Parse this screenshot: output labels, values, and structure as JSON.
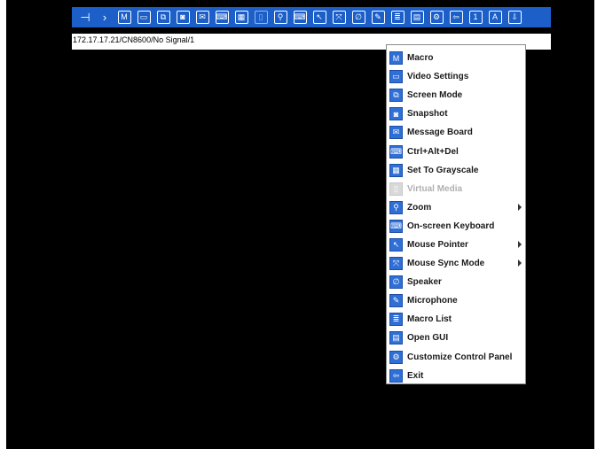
{
  "status_text": "172.17.17.21/CN8600/No Signal/1",
  "colors": {
    "toolbar_bg": "#1c5fc9",
    "screen_bg": "#000000",
    "menu_icon": "#2f6fd6",
    "disabled_text": "#b0b0b0"
  },
  "toolbar": {
    "icons": [
      {
        "name": "pin-icon",
        "glyph": "⊣"
      },
      {
        "name": "expand-arrow-icon",
        "glyph": "›"
      },
      {
        "name": "macro-icon",
        "glyph": "M"
      },
      {
        "name": "video-settings-icon",
        "glyph": "▭"
      },
      {
        "name": "screen-mode-icon",
        "glyph": "⧉"
      },
      {
        "name": "snapshot-icon",
        "glyph": "◙"
      },
      {
        "name": "message-board-icon",
        "glyph": "✉"
      },
      {
        "name": "ctrl-alt-del-icon",
        "glyph": "⌨"
      },
      {
        "name": "grayscale-icon",
        "glyph": "▦"
      },
      {
        "name": "virtual-media-icon",
        "glyph": "▯"
      },
      {
        "name": "zoom-icon",
        "glyph": "⚲"
      },
      {
        "name": "onscreen-keyboard-icon",
        "glyph": "⌨"
      },
      {
        "name": "mouse-pointer-icon",
        "glyph": "↖"
      },
      {
        "name": "mouse-sync-icon",
        "glyph": "⤧"
      },
      {
        "name": "speaker-icon",
        "glyph": "∅"
      },
      {
        "name": "microphone-icon",
        "glyph": "✎"
      },
      {
        "name": "macro-list-icon",
        "glyph": "≣"
      },
      {
        "name": "open-gui-icon",
        "glyph": "▤"
      },
      {
        "name": "customize-panel-icon",
        "glyph": "⚙"
      },
      {
        "name": "exit-icon",
        "glyph": "⇦"
      },
      {
        "name": "lock-num-icon",
        "glyph": "1"
      },
      {
        "name": "lock-caps-icon",
        "glyph": "A"
      },
      {
        "name": "lock-scroll-icon",
        "glyph": "⇩"
      }
    ]
  },
  "menu": {
    "items": [
      {
        "label": "Macro",
        "icon": "macro-icon",
        "glyph": "M",
        "submenu": false,
        "disabled": false
      },
      {
        "label": "Video Settings",
        "icon": "video-settings-icon",
        "glyph": "▭",
        "submenu": false,
        "disabled": false
      },
      {
        "label": "Screen Mode",
        "icon": "screen-mode-icon",
        "glyph": "⧉",
        "submenu": false,
        "disabled": false
      },
      {
        "label": "Snapshot",
        "icon": "snapshot-icon",
        "glyph": "◙",
        "submenu": false,
        "disabled": false
      },
      {
        "label": "Message Board",
        "icon": "message-board-icon",
        "glyph": "✉",
        "submenu": false,
        "disabled": false
      },
      {
        "label": "Ctrl+Alt+Del",
        "icon": "ctrl-alt-del-icon",
        "glyph": "⌨",
        "submenu": false,
        "disabled": false
      },
      {
        "label": "Set To Grayscale",
        "icon": "grayscale-icon",
        "glyph": "▦",
        "submenu": false,
        "disabled": false
      },
      {
        "label": "Virtual Media",
        "icon": "virtual-media-icon",
        "glyph": "▯",
        "submenu": false,
        "disabled": true
      },
      {
        "label": "Zoom",
        "icon": "zoom-icon",
        "glyph": "⚲",
        "submenu": true,
        "disabled": false
      },
      {
        "label": "On-screen Keyboard",
        "icon": "onscreen-keyboard-icon",
        "glyph": "⌨",
        "submenu": false,
        "disabled": false
      },
      {
        "label": "Mouse Pointer",
        "icon": "mouse-pointer-icon",
        "glyph": "↖",
        "submenu": true,
        "disabled": false
      },
      {
        "label": "Mouse Sync Mode",
        "icon": "mouse-sync-icon",
        "glyph": "⤧",
        "submenu": true,
        "disabled": false
      },
      {
        "label": "Speaker",
        "icon": "speaker-icon",
        "glyph": "∅",
        "submenu": false,
        "disabled": false
      },
      {
        "label": "Microphone",
        "icon": "microphone-icon",
        "glyph": "✎",
        "submenu": false,
        "disabled": false
      },
      {
        "label": "Macro List",
        "icon": "macro-list-icon",
        "glyph": "≣",
        "submenu": false,
        "disabled": false
      },
      {
        "label": "Open GUI",
        "icon": "open-gui-icon",
        "glyph": "▤",
        "submenu": false,
        "disabled": false
      },
      {
        "label": "Customize Control Panel",
        "icon": "customize-panel-icon",
        "glyph": "⚙",
        "submenu": false,
        "disabled": false
      },
      {
        "label": "Exit",
        "icon": "exit-icon",
        "glyph": "⇦",
        "submenu": false,
        "disabled": false
      }
    ]
  }
}
